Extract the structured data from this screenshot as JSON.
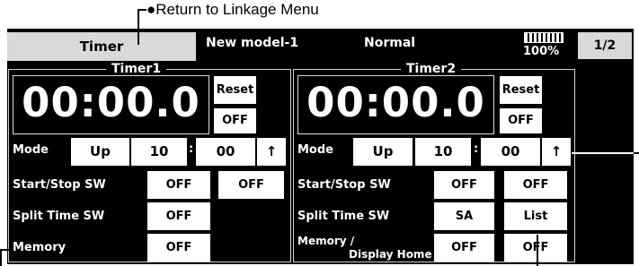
{
  "callouts": {
    "top": "Return to Linkage Menu"
  },
  "header": {
    "tab_label": "Timer",
    "model_name": "New model-1",
    "condition": "Normal",
    "battery_percent": "100%",
    "page": "1/2"
  },
  "timer1": {
    "title": "Timer1",
    "time": "00:00.0",
    "reset_label": "Reset",
    "sw_state": "OFF",
    "mode_label": "Mode",
    "mode_value": "Up",
    "minutes": "10",
    "separator": ":",
    "seconds": "00",
    "arrow": "↑",
    "start_stop_label": "Start/Stop SW",
    "start_stop_value": "OFF",
    "start_stop_value2": "OFF",
    "split_label": "Split Time SW",
    "split_value": "OFF",
    "memory_label": "Memory",
    "memory_value": "OFF"
  },
  "timer2": {
    "title": "Timer2",
    "time": "00:00.0",
    "reset_label": "Reset",
    "sw_state": "OFF",
    "mode_label": "Mode",
    "mode_value": "Up",
    "minutes": "10",
    "separator": ":",
    "seconds": "00",
    "arrow": "↑",
    "start_stop_label": "Start/Stop SW",
    "start_stop_value": "OFF",
    "start_stop_value2": "OFF",
    "split_label": "Split Time SW",
    "split_value": "SA",
    "split_value2": "List",
    "memory_label": "Memory /",
    "display_home_label": "Display Home",
    "memory_value": "OFF",
    "memory_value2": "OFF"
  },
  "colors": {
    "screen_bg": "#000000",
    "button_bg": "#ffffff",
    "frame": "#cfcfcf"
  }
}
